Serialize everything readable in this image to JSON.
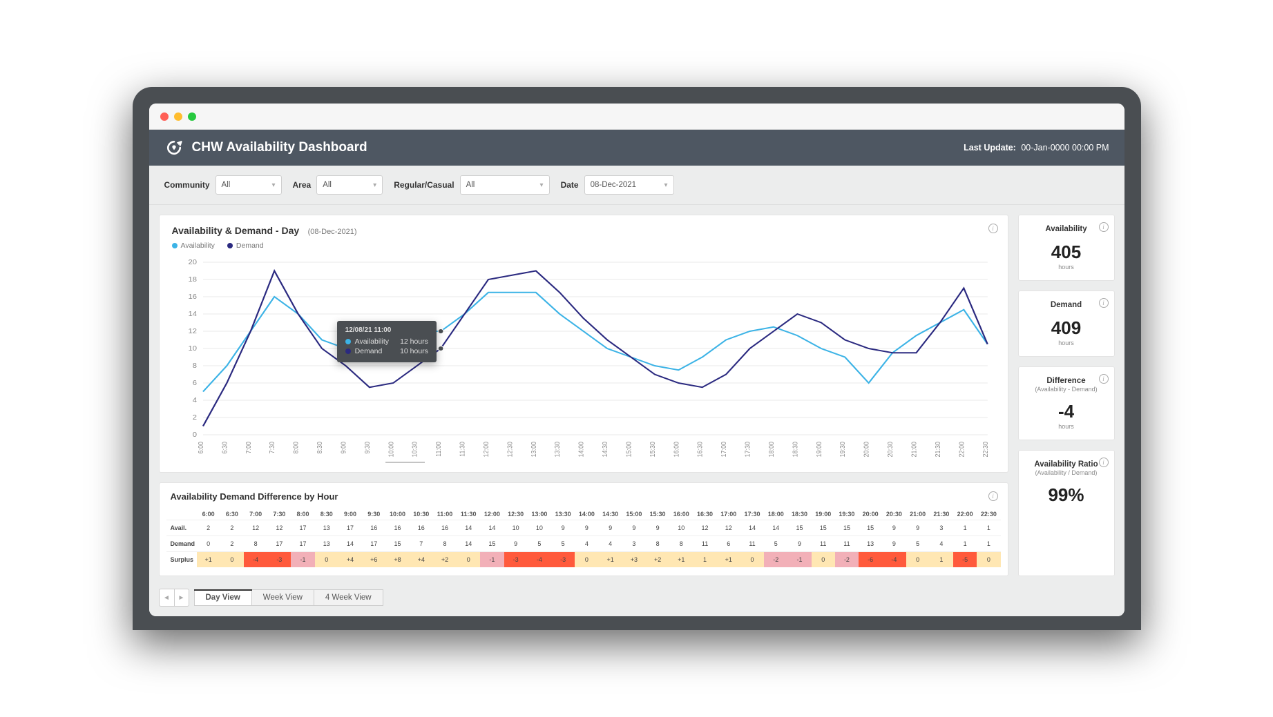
{
  "header": {
    "title": "CHW Availability Dashboard",
    "last_update_label": "Last Update:",
    "last_update_value": "00-Jan-0000 00:00 PM"
  },
  "filters": {
    "community_label": "Community",
    "community_value": "All",
    "area_label": "Area",
    "area_value": "All",
    "regular_casual_label": "Regular/Casual",
    "regular_casual_value": "All",
    "date_label": "Date",
    "date_value": "08-Dec-2021"
  },
  "chart_panel": {
    "title": "Availability & Demand - Day",
    "subtitle": "(08-Dec-2021)",
    "legend_availability": "Availability",
    "legend_demand": "Demand"
  },
  "tooltip": {
    "time": "12/08/21 11:00",
    "availability_label": "Availability",
    "availability_value": "12 hours",
    "demand_label": "Demand",
    "demand_value": "10 hours"
  },
  "diff_panel": {
    "title": "Availability Demand Difference by Hour",
    "row_avail_label": "Avail.",
    "row_demand_label": "Demand",
    "row_surplus_label": "Surplus"
  },
  "tabs": {
    "day": "Day View",
    "week": "Week View",
    "four_week": "4 Week View"
  },
  "stats": {
    "availability": {
      "label": "Availability",
      "value": "405",
      "unit": "hours"
    },
    "demand": {
      "label": "Demand",
      "value": "409",
      "unit": "hours"
    },
    "difference": {
      "label": "Difference",
      "sublabel": "(Availability - Demand)",
      "value": "-4",
      "unit": "hours"
    },
    "ratio": {
      "label": "Availability Ratio",
      "sublabel": "(Availability / Demand)",
      "value": "99%"
    }
  },
  "chart_data": {
    "type": "line",
    "title": "Availability & Demand - Day (08-Dec-2021)",
    "xlabel": "",
    "ylabel": "",
    "ylim": [
      0,
      20
    ],
    "y_ticks": [
      0,
      2,
      4,
      6,
      8,
      10,
      12,
      14,
      16,
      18,
      20
    ],
    "categories": [
      "6:00",
      "6:30",
      "7:00",
      "7:30",
      "8:00",
      "8:30",
      "9:00",
      "9:30",
      "10:00",
      "10:30",
      "11:00",
      "11:30",
      "12:00",
      "12:30",
      "13:00",
      "13:30",
      "14:00",
      "14:30",
      "15:00",
      "15:30",
      "16:00",
      "16:30",
      "17:00",
      "17:30",
      "18:00",
      "18:30",
      "19:00",
      "19:30",
      "20:00",
      "20:30",
      "21:00",
      "21:30",
      "22:00",
      "22:30"
    ],
    "series": [
      {
        "name": "Availability",
        "color": "#3cb3e6",
        "values": [
          5,
          8,
          12,
          16,
          14,
          11,
          10,
          10,
          12,
          12,
          12,
          14,
          16.5,
          16.5,
          16.5,
          14,
          12,
          10,
          9,
          8,
          7.5,
          9,
          11,
          12,
          12.5,
          11.5,
          10,
          9,
          6,
          9.5,
          11.5,
          13,
          14.5,
          10.5
        ]
      },
      {
        "name": "Demand",
        "color": "#2b2a80",
        "values": [
          1,
          6,
          12,
          19,
          14,
          10,
          8,
          5.5,
          6,
          8,
          10,
          14,
          18,
          18.5,
          19,
          16.5,
          13.5,
          11,
          9,
          7,
          6,
          5.5,
          7,
          10,
          12,
          14,
          13,
          11,
          10,
          9.5,
          9.5,
          13,
          17,
          10.5
        ]
      }
    ],
    "diff_table": {
      "times": [
        "6:00",
        "6:30",
        "7:00",
        "7:30",
        "8:00",
        "8:30",
        "9:00",
        "9:30",
        "10:00",
        "10:30",
        "11:00",
        "11:30",
        "12:00",
        "12:30",
        "13:00",
        "13:30",
        "14:00",
        "14:30",
        "15:00",
        "15:30",
        "16:00",
        "16:30",
        "17:00",
        "17:30",
        "18:00",
        "18:30",
        "19:00",
        "19:30",
        "20:00",
        "20:30",
        "21:00",
        "21:30",
        "22:00",
        "22:30"
      ],
      "avail": [
        2,
        2,
        12,
        12,
        17,
        13,
        17,
        16,
        16,
        16,
        16,
        14,
        14,
        10,
        10,
        9,
        9,
        9,
        9,
        9,
        10,
        12,
        12,
        14,
        14,
        15,
        15,
        15,
        15,
        9,
        9,
        3,
        1,
        1
      ],
      "demand": [
        0,
        2,
        8,
        17,
        17,
        13,
        14,
        17,
        15,
        7,
        8,
        14,
        15,
        9,
        5,
        5,
        4,
        4,
        3,
        8,
        8,
        11,
        6,
        11,
        5,
        9,
        11,
        11,
        13,
        9,
        5,
        4,
        1,
        1
      ],
      "surplus": [
        "+1",
        "0",
        "-4",
        "-3",
        "-1",
        "0",
        "+4",
        "+6",
        "+8",
        "+4",
        "+2",
        "0",
        "-1",
        "-3",
        "-4",
        "-3",
        "0",
        "+1",
        "+3",
        "+2",
        "+1",
        "1",
        "+1",
        "0",
        "-2",
        "-1",
        "0",
        "-2",
        "-6",
        "-4",
        "0",
        "1",
        "-5",
        "0"
      ]
    }
  }
}
